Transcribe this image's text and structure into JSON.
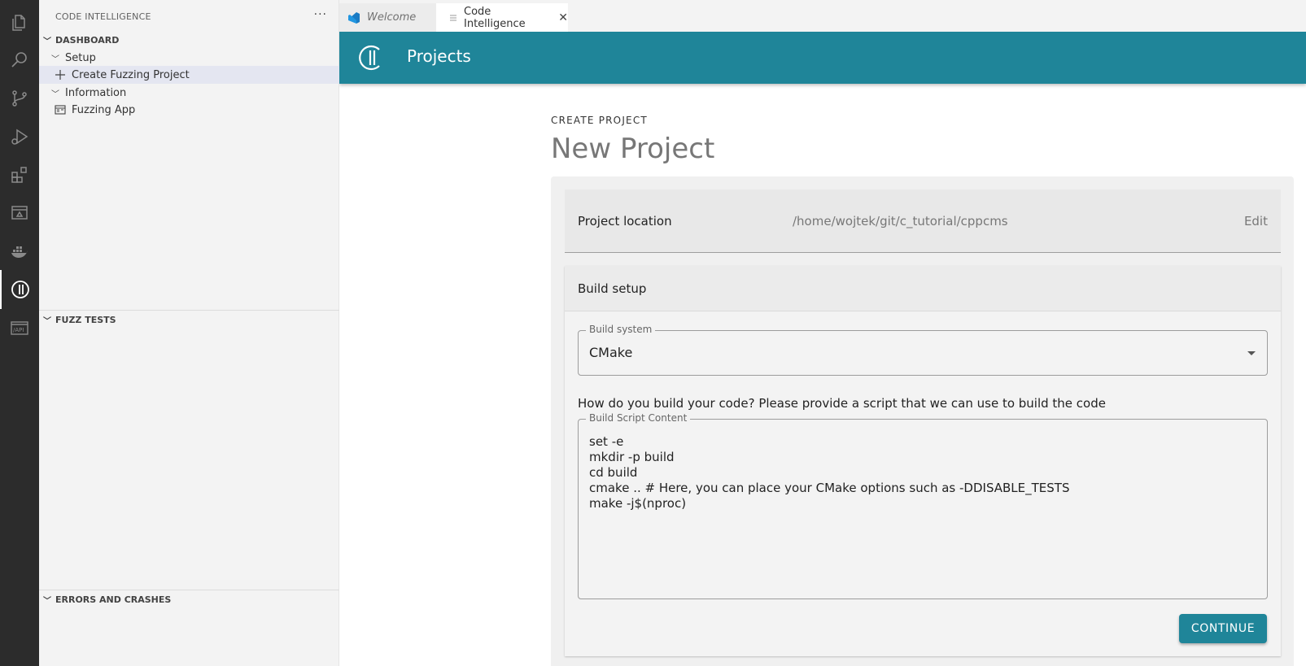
{
  "sidebar": {
    "title": "CODE INTELLIGENCE",
    "more": "···",
    "dashboard": {
      "label": "DASHBOARD",
      "setup": "Setup",
      "create_project": "Create Fuzzing Project",
      "information": "Information",
      "fuzzing_app": "Fuzzing App"
    },
    "fuzz_tests": "FUZZ TESTS",
    "errors": "ERRORS AND CRASHES"
  },
  "tabs": [
    {
      "label": "Welcome",
      "active": false
    },
    {
      "label": "Code Intelligence",
      "active": true
    }
  ],
  "appbar": {
    "title": "Projects"
  },
  "page": {
    "overline": "CREATE PROJECT",
    "title": "New Project",
    "location": {
      "label": "Project location",
      "path": "/home/wojtek/git/c_tutorial/cppcms",
      "edit": "Edit"
    },
    "build": {
      "header": "Build setup",
      "system_label": "Build system",
      "system_value": "CMake",
      "question": "How do you build your code? Please provide a script that we can use to build the code",
      "script_label": "Build Script Content",
      "script": "set -e\nmkdir -p build\ncd build\ncmake .. # Here, you can place your CMake options such as -DDISABLE_TESTS\nmake -j$(nproc)",
      "continue": "CONTINUE"
    }
  },
  "colors": {
    "accent": "#1f8599",
    "activity_bar": "#2c2c2c"
  }
}
